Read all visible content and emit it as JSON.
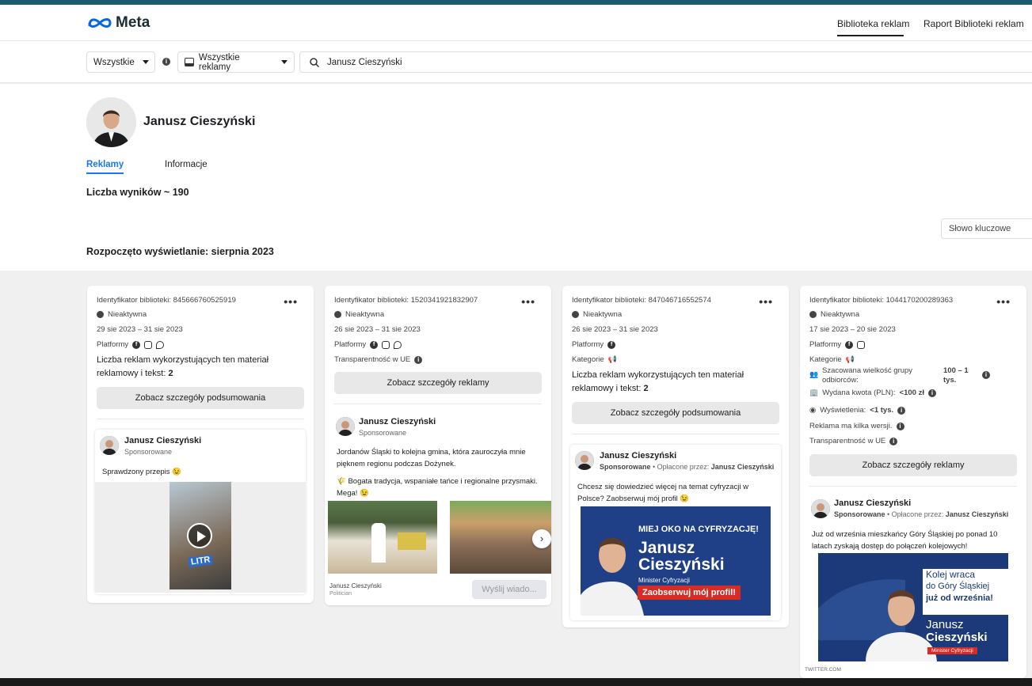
{
  "header": {
    "logo": "Meta",
    "nav": [
      "Biblioteka reklam",
      "Raport Biblioteki reklam"
    ]
  },
  "search": {
    "country": "Wszystkie",
    "ad_type": "Wszystkie reklamy",
    "query": "Janusz Cieszyński"
  },
  "profile": {
    "name": "Janusz Cieszyński",
    "tabs": [
      "Reklamy",
      "Informacje"
    ],
    "results": "Liczba wyników ~ 190",
    "keyword_placeholder": "Słowo kluczowe",
    "started": "Rozpoczęto wyświetlanie: sierpnia 2023"
  },
  "cards": [
    {
      "id": "Identyfikator biblioteki: 845666760525919",
      "status": "Nieaktywna",
      "dates": "29 sie 2023 – 31 sie 2023",
      "platforms_label": "Platformy",
      "multi_text": "Liczba reklam wykorzystujących ten materiał reklamowy i tekst:",
      "multi_count": "2",
      "button": "Zobacz szczegóły podsumowania",
      "post_name": "Janusz Cieszyński",
      "post_sponsored": "Sponsorowane",
      "post_text": "Sprawdzony przepis 😉",
      "video_caption": "LITR"
    },
    {
      "id": "Identyfikator biblioteki: 1520341921832907",
      "status": "Nieaktywna",
      "dates": "26 sie 2023 – 31 sie 2023",
      "platforms_label": "Platformy",
      "transparency": "Transparentność w UE",
      "button": "Zobacz szczegóły reklamy",
      "post_name": "Janusz Cieszyński",
      "post_sponsored": "Sponsorowane",
      "post_text": "Jordanów Śląski to kolejna gmina, która zauroczyła mnie pięknem regionu podczas Dożynek.",
      "post_text2": "🌾 Bogata tradycja, wspaniałe tańce i regionalne przysmaki. Mega! 😉",
      "page_name": "Janusz Cieszyński",
      "page_cat": "Politician",
      "send_button": "Wyślij wiado..."
    },
    {
      "id": "Identyfikator biblioteki: 847046716552574",
      "status": "Nieaktywna",
      "dates": "26 sie 2023 – 31 sie 2023",
      "platforms_label": "Platformy",
      "category_label": "Kategorie",
      "multi_text": "Liczba reklam wykorzystujących ten materiał reklamowy i tekst:",
      "multi_count": "2",
      "button": "Zobacz szczegóły podsumowania",
      "post_name": "Janusz Cieszyński",
      "post_sponsored": "Sponsorowane",
      "post_paid": "Opłacone przez:",
      "post_payer": "Janusz Cieszyński",
      "post_text": "Chcesz się dowiedzieć więcej na temat cyfryzacji w Polsce? Zaobserwuj mój profil 😉",
      "banner_top": "MIEJ OKO NA CYFRYZACJĘ!",
      "banner_name1": "Janusz",
      "banner_name2": "Cieszyński",
      "banner_role": "Minister Cyfryzacji",
      "banner_cta": "Zaobserwuj mój profil!"
    },
    {
      "id": "Identyfikator biblioteki: 1044170200289363",
      "status": "Nieaktywna",
      "dates": "17 sie 2023 – 20 sie 2023",
      "platforms_label": "Platformy",
      "category_label": "Kategorie",
      "audience_label": "Szacowana wielkość grupy odbiorców:",
      "audience_value": "100 – 1 tys.",
      "spend_label": "Wydana kwota (PLN):",
      "spend_value": "<100 zł",
      "impressions_label": "Wyświetlenia:",
      "impressions_value": "<1 tys.",
      "versions": "Reklama ma kilka wersji.",
      "transparency": "Transparentność w UE",
      "button": "Zobacz szczegóły reklamy",
      "post_name": "Janusz Cieszyński",
      "post_sponsored": "Sponsorowane",
      "post_paid": "Opłacone przez:",
      "post_payer": "Janusz Cieszyński",
      "post_text": "Już od września mieszkańcy Góry Śląskiej po ponad 10 latach zyskają dostęp do połączeń kolejowych!",
      "banner_l1": "Kolej wraca",
      "banner_l2": "do Góry Śląskiej",
      "banner_l3": "już od września!",
      "banner_name1": "Janusz",
      "banner_name2": "Cieszyński",
      "banner_role": "Minister Cyfryzacji",
      "source": "TWITTER.COM"
    }
  ]
}
